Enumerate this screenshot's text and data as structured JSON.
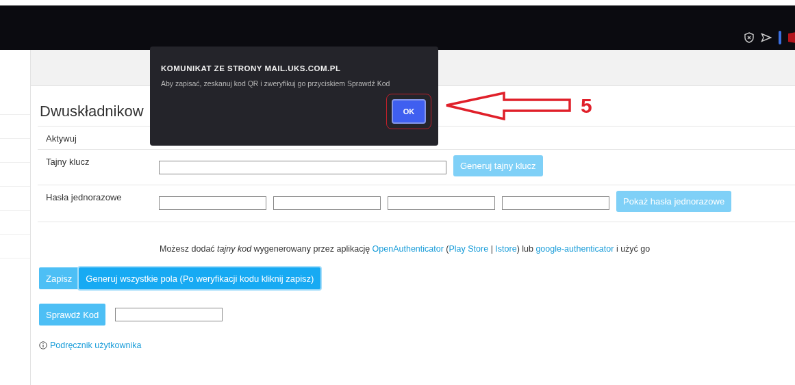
{
  "page_title": "Dwuskładnikow",
  "rows": [
    {
      "label": "Aktywuj",
      "kind": "plain"
    },
    {
      "label": "Tajny klucz",
      "kind": "key",
      "button": "Generuj tajny klucz"
    },
    {
      "label": "Hasła jednorazowe",
      "kind": "codes",
      "button": "Pokaż hasła jednorazowe"
    }
  ],
  "info": [
    {
      "kind": "text",
      "text": "Możesz dodać *tajny kod* wygenerowany przez aplikację "
    },
    {
      "kind": "link",
      "text": "OpenAuthenticator"
    },
    {
      "kind": "text",
      "text": " ("
    },
    {
      "kind": "link",
      "text": "Play Store"
    },
    {
      "kind": "text",
      "text": " | "
    },
    {
      "kind": "link",
      "text": "Istore"
    },
    {
      "kind": "text",
      "text": ") lub "
    },
    {
      "kind": "link",
      "text": "google-authenticator"
    },
    {
      "kind": "text",
      "text": " i użyć go"
    }
  ],
  "save_button": "Zapisz",
  "generate_all_button": "Generuj wszystkie pola (Po weryfikacji kodu kliknij zapisz)",
  "check_button": "Sprawdź Kod",
  "manual_link": "Podręcznik użytkownika",
  "dialog": {
    "title": "KOMUNIKAT ZE STRONY MAIL.UKS.COM.PL",
    "message": "Aby zapisać, zeskanuj kod QR i zweryfikuj go przyciskiem Sprawdź Kod",
    "ok": "OK"
  },
  "annotation": {
    "number": "5"
  }
}
